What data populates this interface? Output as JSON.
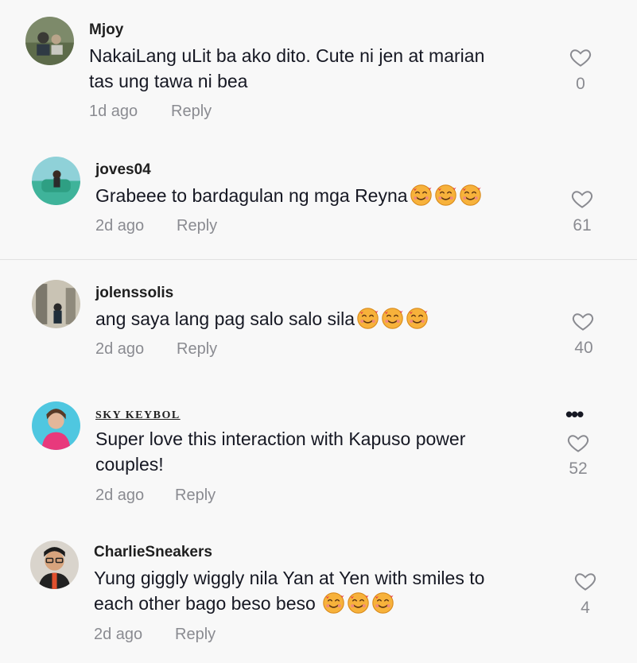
{
  "comments": [
    {
      "username": "Mjoy",
      "text_lines": [
        "NakaiLang uLit ba ako dito. Cute ni jen at marian",
        "tas ung tawa ni bea"
      ],
      "emoji_count": 0,
      "time": "1d ago",
      "reply": "Reply",
      "likes": "0"
    },
    {
      "username": "joves04",
      "text_lines": [
        "Grabeee to bardagulan ng mga Reyna"
      ],
      "emoji_count": 3,
      "time": "2d ago",
      "reply": "Reply",
      "likes": "61"
    },
    {
      "username": "jolenssolis",
      "text_lines": [
        "ang saya lang pag salo salo sila"
      ],
      "emoji_count": 3,
      "time": "2d ago",
      "reply": "Reply",
      "likes": "40"
    },
    {
      "username": "SKY KEYBOL",
      "text_lines": [
        "Super love this interaction with Kapuso power",
        "couples!"
      ],
      "emoji_count": 0,
      "time": "2d ago",
      "reply": "Reply",
      "likes": "52",
      "has_more_menu": true
    },
    {
      "username": "CharlieSneakers",
      "text_lines": [
        "Yung giggly wiggly nila Yan at Yen with smiles to",
        "each other bago beso beso "
      ],
      "emoji_count": 3,
      "time": "2d ago",
      "reply": "Reply",
      "likes": "4"
    }
  ],
  "more_menu": "•••",
  "icons": {
    "like": "heart-outline-icon",
    "emoji": "smiling-face-with-hearts-emoji"
  },
  "colors": {
    "background": "#f8f8f8",
    "text": "#161823",
    "secondary": "#8a8b91"
  }
}
